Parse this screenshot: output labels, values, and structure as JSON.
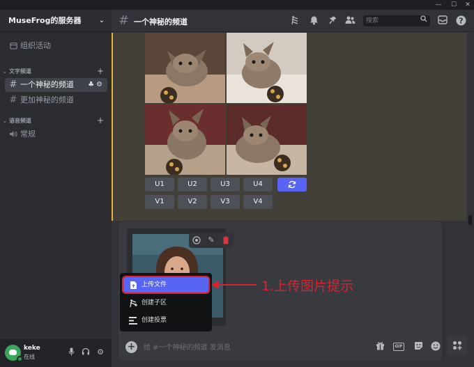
{
  "window": {
    "controls": [
      "—",
      "☐",
      "✕"
    ]
  },
  "server": {
    "name": "MuseFrog的服务器"
  },
  "sidebar": {
    "events_label": "组织活动",
    "categories": [
      {
        "label": "文字频道"
      },
      {
        "label": "语音频道"
      }
    ],
    "text_channels": [
      {
        "label": "一个神秘的频道",
        "active": true
      },
      {
        "label": "更加神秘的频道",
        "active": false
      }
    ],
    "voice_channels": [
      {
        "label": "常规"
      }
    ]
  },
  "user": {
    "name": "keke",
    "status": "在线"
  },
  "header": {
    "channel_name": "一个神秘的频道",
    "search_placeholder": "搜索",
    "icons": [
      "threads-icon",
      "bell-icon",
      "pin-icon",
      "members-icon",
      "inbox-icon",
      "help-icon"
    ]
  },
  "message": {
    "image_grid": {
      "alt": "kitten-grid",
      "count": 4
    },
    "upscale_buttons": [
      "U1",
      "U2",
      "U3",
      "U4"
    ],
    "variation_buttons": [
      "V1",
      "V2",
      "V3",
      "V4"
    ],
    "refresh_icon": "refresh-icon"
  },
  "composer": {
    "placeholder": "给 #一个神秘的频道 发消息",
    "gif_label": "GIF"
  },
  "menu": {
    "items": [
      {
        "label": "上传文件",
        "icon": "upload-file-icon",
        "highlighted": true
      },
      {
        "label": "创建子区",
        "icon": "thread-icon",
        "highlighted": false
      },
      {
        "label": "创建投票",
        "icon": "poll-icon",
        "highlighted": false
      }
    ]
  },
  "annotation": {
    "text": "1.上传图片提示",
    "color": "#e0202a"
  },
  "colors": {
    "accent": "#5865f2",
    "highlight_bar": "#f0b232",
    "online": "#23a559",
    "danger": "#da373c"
  }
}
